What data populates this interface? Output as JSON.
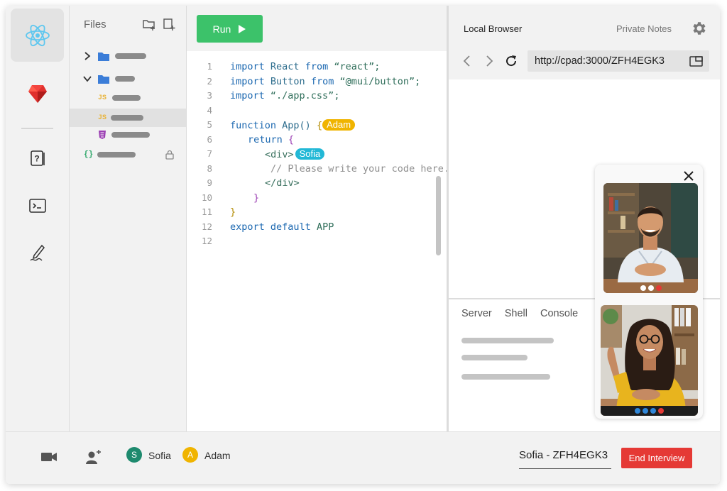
{
  "explorer": {
    "title": "Files"
  },
  "editor": {
    "run_label": "Run",
    "lines": [
      {
        "n": "1"
      },
      {
        "n": "2"
      },
      {
        "n": "3"
      },
      {
        "n": "4"
      },
      {
        "n": "5"
      },
      {
        "n": "6"
      },
      {
        "n": "7"
      },
      {
        "n": "8"
      },
      {
        "n": "9"
      },
      {
        "n": "10"
      },
      {
        "n": "11"
      },
      {
        "n": "12"
      }
    ],
    "code": {
      "l1_kw": "import",
      "l1_id": " React ",
      "l1_from": "from",
      "l1_str": " “react”;",
      "l2_kw": "import",
      "l2_id": " Button ",
      "l2_from": "from",
      "l2_str": " “@mui/button”;",
      "l3_kw": "import",
      "l3_str": " “./app.css”;",
      "l5_kw": "function",
      "l5_id": " App() ",
      "l5_brace": "{",
      "l6_kw": "return",
      "l6_brace": " {",
      "l7_open": "<div>",
      "l8_comment": "// Please write your code here.",
      "l9_close": "</div>",
      "l10_brace": "}",
      "l11_brace": "}",
      "l12_kw": "export",
      "l12_kw2": " default",
      "l12_id": " APP"
    },
    "cursors": {
      "adam": "Adam",
      "sofia": "Sofia"
    }
  },
  "browser": {
    "tab_local": "Local Browser",
    "tab_notes": "Private Notes",
    "url": "http://cpad:3000/ZFH4EGK3"
  },
  "terminal": {
    "tabs": [
      "Server",
      "Shell",
      "Console"
    ]
  },
  "footer": {
    "participants": [
      {
        "initial": "S",
        "name": "Sofia",
        "color": "#1e8a6e"
      },
      {
        "initial": "A",
        "name": "Adam",
        "color": "#f0b400"
      }
    ],
    "session": "Sofia - ZFH4EGK3",
    "end_label": "End Interview"
  },
  "colors": {
    "run": "#3cc26a",
    "end": "#e53935",
    "adam_tag": "#f0b400",
    "sofia_tag": "#22b8d6"
  }
}
